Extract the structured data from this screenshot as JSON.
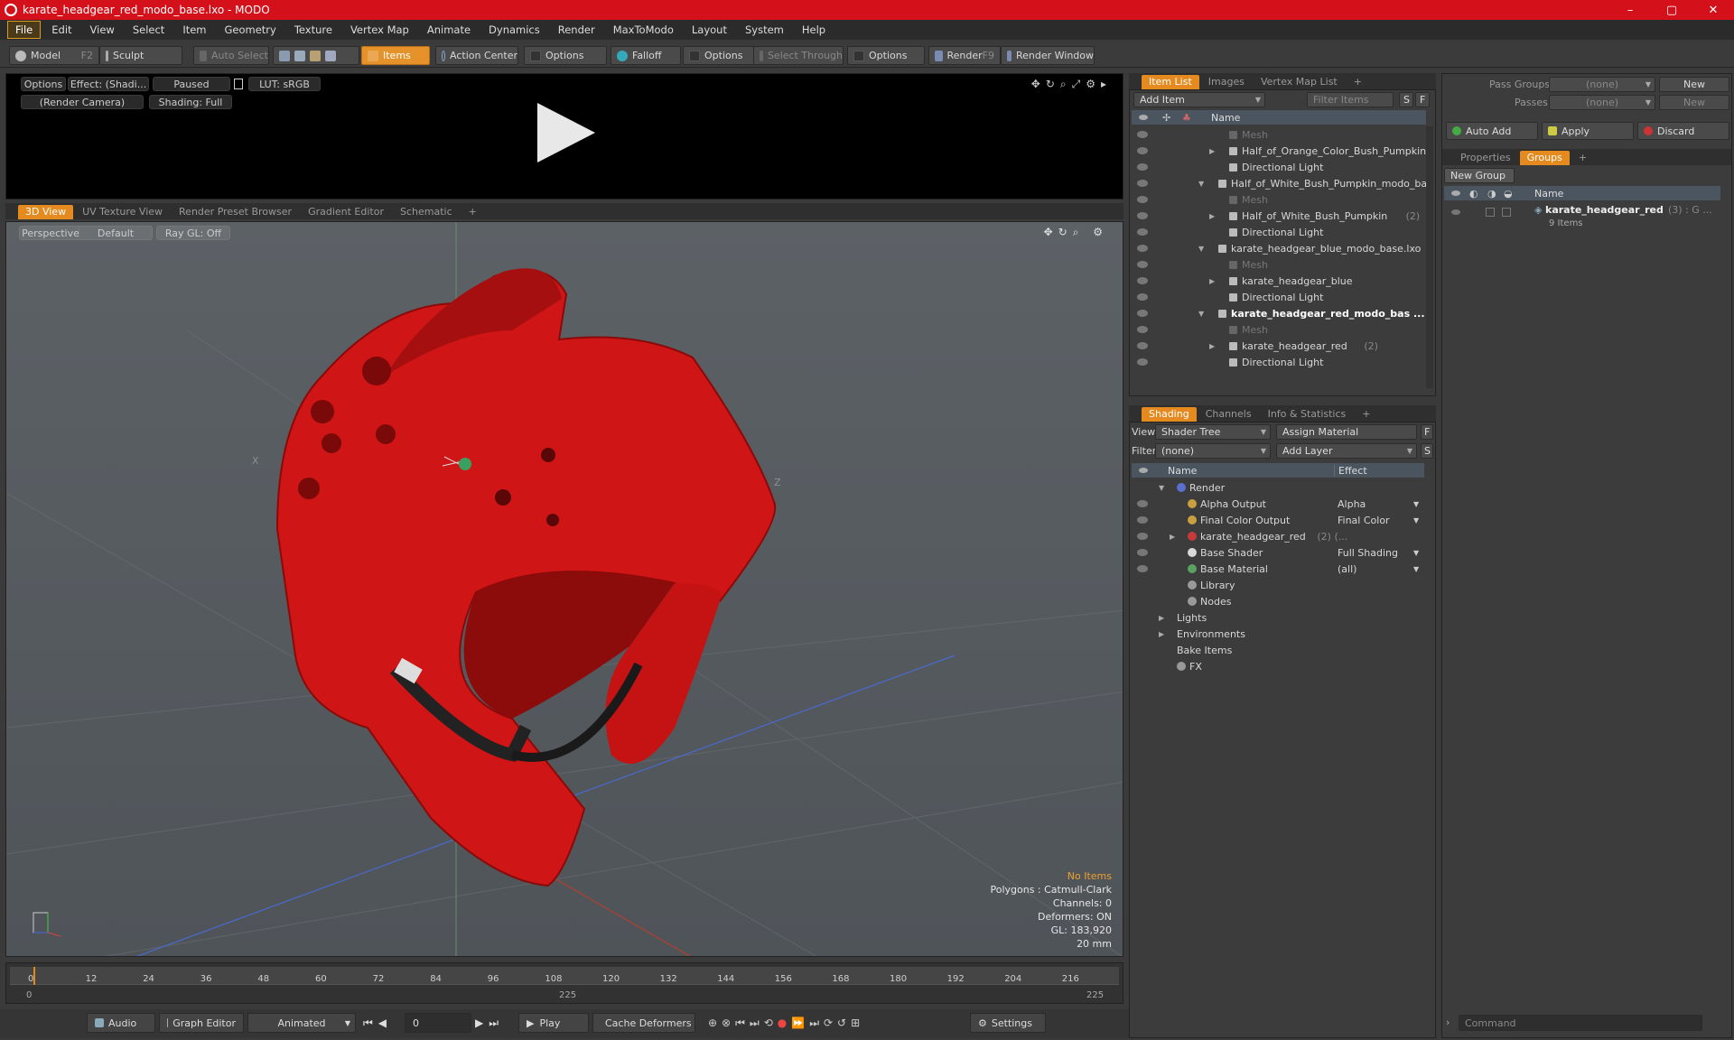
{
  "window": {
    "title": "karate_headgear_red_modo_base.lxo - MODO",
    "minimize": "–",
    "maximize": "▢",
    "close": "✕"
  },
  "menu": [
    "File",
    "Edit",
    "View",
    "Select",
    "Item",
    "Geometry",
    "Texture",
    "Vertex Map",
    "Animate",
    "Dynamics",
    "Render",
    "MaxToModo",
    "Layout",
    "System",
    "Help"
  ],
  "toolbar": {
    "model": "Model",
    "model_key": "F2",
    "sculpt": "Sculpt",
    "auto_select": "Auto Select",
    "items": "Items",
    "action_center": "Action Center",
    "options1": "Options",
    "falloff": "Falloff",
    "options2": "Options",
    "select_through": "Select Through",
    "options3": "Options",
    "render": "Render",
    "render_key": "F9",
    "render_window": "Render Window"
  },
  "render_preview": {
    "options": "Options",
    "effect": "Effect: (Shadi...",
    "paused": "Paused",
    "lut": "LUT: sRGB",
    "camera": "(Render Camera)",
    "shading": "Shading: Full"
  },
  "view_tabs": [
    "3D View",
    "UV Texture View",
    "Render Preset Browser",
    "Gradient Editor",
    "Schematic",
    "+"
  ],
  "viewport": {
    "perspective": "Perspective",
    "default": "Default",
    "raygl": "Ray GL: Off",
    "axis_x": "X",
    "axis_z": "Z",
    "info": [
      "No Items",
      "Polygons : Catmull-Clark",
      "Channels: 0",
      "Deformers: ON",
      "GL: 183,920",
      "20 mm"
    ]
  },
  "timeline": {
    "ticks": [
      "0",
      "12",
      "24",
      "36",
      "48",
      "60",
      "72",
      "84",
      "96",
      "108",
      "120",
      "132",
      "144",
      "156",
      "168",
      "180",
      "192",
      "204",
      "216"
    ],
    "start": "0",
    "mid": "225",
    "end": "225"
  },
  "bottom": {
    "audio": "Audio",
    "graph_editor": "Graph Editor",
    "animated": "Animated",
    "frame": "0",
    "play": "Play",
    "cache": "Cache Deformers",
    "settings": "Settings"
  },
  "item_list": {
    "tabs": [
      "Item List",
      "Images",
      "Vertex Map List",
      "+"
    ],
    "add_item": "Add Item",
    "filter": "Filter Items",
    "f": "F",
    "s": "S",
    "col_name": "Name",
    "rows": [
      {
        "label": "Mesh",
        "indent": 2,
        "dim": true,
        "arrow": "",
        "count": ""
      },
      {
        "label": "Half_of_Orange_Color_Bush_Pumpkin...",
        "indent": 2,
        "dim": false,
        "arrow": "▶",
        "count": ""
      },
      {
        "label": "Directional Light",
        "indent": 2,
        "dim": false,
        "arrow": "",
        "count": ""
      },
      {
        "label": "Half_of_White_Bush_Pumpkin_modo_ba...",
        "indent": 1,
        "dim": false,
        "arrow": "▼",
        "count": ""
      },
      {
        "label": "Mesh",
        "indent": 2,
        "dim": true,
        "arrow": "",
        "count": ""
      },
      {
        "label": "Half_of_White_Bush_Pumpkin",
        "indent": 2,
        "dim": false,
        "arrow": "▶",
        "count": "(2)"
      },
      {
        "label": "Directional Light",
        "indent": 2,
        "dim": false,
        "arrow": "",
        "count": ""
      },
      {
        "label": "karate_headgear_blue_modo_base.lxo",
        "indent": 1,
        "dim": false,
        "arrow": "▼",
        "count": ""
      },
      {
        "label": "Mesh",
        "indent": 2,
        "dim": true,
        "arrow": "",
        "count": ""
      },
      {
        "label": "karate_headgear_blue",
        "indent": 2,
        "dim": false,
        "arrow": "▶",
        "count": ""
      },
      {
        "label": "Directional Light",
        "indent": 2,
        "dim": false,
        "arrow": "",
        "count": ""
      },
      {
        "label": "karate_headgear_red_modo_bas ...",
        "indent": 1,
        "dim": false,
        "arrow": "▼",
        "count": "",
        "bold": true
      },
      {
        "label": "Mesh",
        "indent": 2,
        "dim": true,
        "arrow": "",
        "count": ""
      },
      {
        "label": "karate_headgear_red",
        "indent": 2,
        "dim": false,
        "arrow": "▶",
        "count": "(2)"
      },
      {
        "label": "Directional Light",
        "indent": 2,
        "dim": false,
        "arrow": "",
        "count": ""
      }
    ]
  },
  "shading": {
    "tabs": [
      "Shading",
      "Channels",
      "Info & Statistics",
      "+"
    ],
    "view_label": "View",
    "view_value": "Shader Tree",
    "assign_material": "Assign Material",
    "filter_label": "Filter",
    "filter_value": "(none)",
    "add_layer": "Add Layer",
    "f": "F",
    "s": "S",
    "col_name": "Name",
    "col_effect": "Effect",
    "rows": [
      {
        "label": "Render",
        "effect": "",
        "indent": 0,
        "arrow": "▼",
        "color": "#5a6fd0",
        "eye": false
      },
      {
        "label": "Alpha Output",
        "effect": "Alpha",
        "indent": 1,
        "arrow": "",
        "color": "#c8a040",
        "eye": true
      },
      {
        "label": "Final Color Output",
        "effect": "Final Color",
        "indent": 1,
        "arrow": "",
        "color": "#c8a040",
        "eye": true
      },
      {
        "label": "karate_headgear_red",
        "effect": "",
        "indent": 1,
        "arrow": "▶",
        "color": "#c83a3a",
        "eye": true,
        "count": "(2) (..."
      },
      {
        "label": "Base Shader",
        "effect": "Full Shading",
        "indent": 1,
        "arrow": "",
        "color": "#d8d8d8",
        "eye": true
      },
      {
        "label": "Base Material",
        "effect": "(all)",
        "indent": 1,
        "arrow": "",
        "color": "#5aa060",
        "eye": true
      },
      {
        "label": "Library",
        "effect": "",
        "indent": 1,
        "arrow": "",
        "color": "#999",
        "eye": false
      },
      {
        "label": "Nodes",
        "effect": "",
        "indent": 1,
        "arrow": "",
        "color": "#999",
        "eye": false
      },
      {
        "label": "Lights",
        "effect": "",
        "indent": 0,
        "arrow": "▶",
        "color": "",
        "eye": false
      },
      {
        "label": "Environments",
        "effect": "",
        "indent": 0,
        "arrow": "▶",
        "color": "",
        "eye": false
      },
      {
        "label": "Bake Items",
        "effect": "",
        "indent": 0,
        "arrow": "",
        "color": "",
        "eye": false
      },
      {
        "label": "FX",
        "effect": "",
        "indent": 0,
        "arrow": "",
        "color": "#999",
        "eye": false
      }
    ]
  },
  "groups": {
    "pass_groups_label": "Pass Groups",
    "pass_groups_value": "(none)",
    "new": "New",
    "passes_label": "Passes",
    "passes_value": "(none)",
    "new2": "New",
    "auto_add": "Auto Add",
    "apply": "Apply",
    "discard": "Discard",
    "tabs": [
      "Properties",
      "Groups",
      "+"
    ],
    "new_group": "New Group",
    "col_name": "Name",
    "item_name": "karate_headgear_red",
    "item_count": "(3) : G ...",
    "item_sub": "9 Items",
    "command": "Command"
  }
}
